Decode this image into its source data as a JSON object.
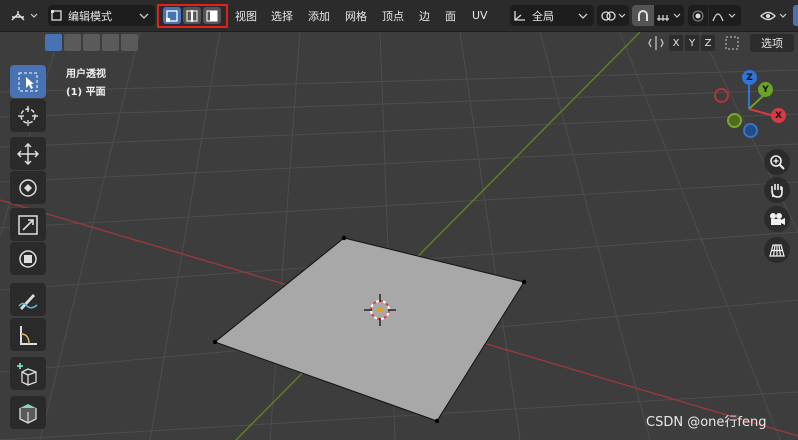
{
  "header": {
    "mode": "编辑模式",
    "menu": [
      "视图",
      "选择",
      "添加",
      "网格",
      "顶点",
      "边",
      "面",
      "UV"
    ],
    "orientation": "全局",
    "options_label": "选项"
  },
  "viewport": {
    "view_name": "用户透视",
    "object_name": "(1) 平面"
  },
  "axis_buttons": [
    "X",
    "Y",
    "Z"
  ],
  "gizmo": {
    "x": "X",
    "y": "Y",
    "z": "Z"
  },
  "watermark": "CSDN @one行feng",
  "colors": {
    "accent": "#4772b3",
    "highlight_box": "#e0211e",
    "grid_bg": "#3d3d3d",
    "x_axis": "#b33b3b",
    "y_axis": "#6f9a2a",
    "plane_face": "#a8a8a8"
  },
  "icons": {
    "editor_type": "view3d-icon",
    "select_modes": [
      "vertex-select-icon",
      "edge-select-icon",
      "face-select-icon"
    ],
    "tools": [
      "select-box-icon",
      "cursor-icon",
      "move-icon",
      "rotate-icon",
      "scale-icon",
      "transform-icon",
      "annotate-icon",
      "measure-icon",
      "add-cube-icon",
      "extrude-icon"
    ],
    "nav": [
      "zoom-icon",
      "pan-hand-icon",
      "camera-icon",
      "grid-view-icon"
    ]
  }
}
